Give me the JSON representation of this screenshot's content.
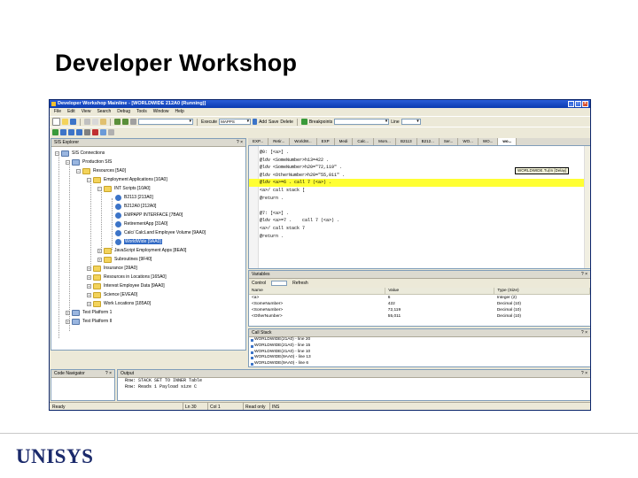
{
  "slide": {
    "title": "Developer Workshop",
    "logo": "UNISYS"
  },
  "window": {
    "title": "Developer Workshop Mainline - [WORLDWIDE 212A0 (Running)]",
    "controls": [
      "_",
      "□",
      "×"
    ]
  },
  "menu": [
    "File",
    "Edit",
    "View",
    "Search",
    "Debug",
    "Tools",
    "Window",
    "Help"
  ],
  "toolbar": {
    "execute_label": "Execute",
    "execute_value": "MAPPS",
    "add_label": "Add",
    "save_label": "Save",
    "delete_label": "Delete",
    "breakpoints_label": "Breakpoints",
    "line_label": "Line"
  },
  "explorer": {
    "title": "SIS Explorer",
    "pin": "? ×",
    "nodes": {
      "n0": "SIS Connections",
      "n1": "Production SIS",
      "n2": "Resources [5A0]",
      "n3": "Employment Applications [10A0]",
      "n4": "INT Scripts [10A0]",
      "n5": "B2113 [213A0]",
      "n6": "B212A0 [212A0]",
      "n7": "EMPAPP INTERFACE [7BA0]",
      "n8": "RetirementApp [31A0]",
      "n9": "Calc/ CalcLand Employee Volume [9AA0]",
      "n10": "WorldWide [9AA0]",
      "n11": "JavaScript Employment Apps [8EA0]",
      "n12": "Subroutines [9F40]",
      "n13": "Insurance [39A0]",
      "n14": "Resources in Locations [165A0]",
      "n15": "Interest Employee Data [9AA0]",
      "n16": "Science [EVEA0]",
      "n17": "Work Locations [185A0]",
      "n18": "Test Platform 1",
      "n19": "Test Platform II"
    }
  },
  "editor": {
    "tabs": [
      "EXP...",
      "Retir...",
      "WorldW...",
      "EXP",
      "Medi",
      "Calc...",
      "Mom...",
      "B2113",
      "B212...",
      "Ser...",
      "WO...",
      "WO...",
      "wo..."
    ],
    "active_tab_index": 12,
    "tooltip": "WORLDWIDE.Tu(In [Delay]",
    "lines": [
      "@0: [<a>] .",
      "@ldv <SomeNumber>h13=422 .",
      "@ldv <SomeNumber>h20=\"72,119\" .",
      "@ldv <OtherNumber>h20=\"55,011\" .",
      "@ldv <a>=6 . call 7 (<a>) .",
      "<a>/ call stack [",
      "@return .",
      "",
      "@7: [<a>] .",
      "@ldv <a>=7 .    call 7 (<a>) .",
      "<a>/ call stack 7",
      "@return ."
    ],
    "highlight_line": 4
  },
  "variables": {
    "title": "Variables",
    "control_label": "Control",
    "refresh_label": "Refresh",
    "columns": [
      "Name",
      "Value",
      "Type (Size)"
    ],
    "rows": [
      [
        "<a>",
        "6",
        "Integer (2)"
      ],
      [
        "<SomeNumber>",
        "422",
        "Decimal (10)"
      ],
      [
        "<SomeNumber>",
        "72,119",
        "Decimal (10)"
      ],
      [
        "<OtherNumber>",
        "55,011",
        "Decimal (10)"
      ]
    ]
  },
  "callstack": {
    "title": "Call Stack",
    "items": [
      "WORLDWIDE(21A0) - line 20",
      "WORLDWIDE(21A0) - line 15",
      "WORLDWIDE(21A0) - line 10",
      "WORLDWIDE(9AA0) - line 13",
      "WORLDWIDE(9AA0) - line 6"
    ]
  },
  "code_navigator": {
    "title": "Code Navigator"
  },
  "output": {
    "title": "Output",
    "lines": [
      "Row: STACK SET TO INNER Table",
      "Row: Reads 1 Payload size C"
    ]
  },
  "statusbar": {
    "state": "Ready",
    "line": "Ln 30",
    "col": "Col 1",
    "mode": "Read only",
    "ins": "INS"
  },
  "colors": {
    "title_bar": "#0a3bb0",
    "highlight": "#ffff33",
    "logo": "#1b2a6b"
  }
}
